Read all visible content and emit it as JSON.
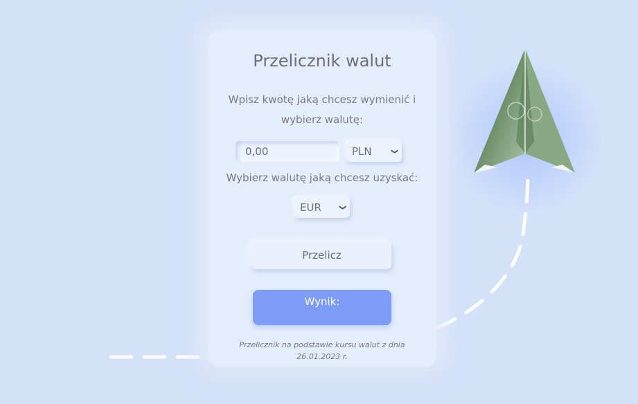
{
  "card": {
    "title": "Przelicznik walut",
    "instruction": "Wpisz kwotę jaką chcesz wymienić i wybierz walutę:",
    "amount_value": "0,00",
    "from_currency": "PLN",
    "target_instruction": "Wybierz walutę jaką chcesz uzyskać:",
    "to_currency": "EUR",
    "convert_label": "Przelicz",
    "result_label": "Wynik:",
    "footnote": "Przelicznik na podstawie kursu walut z dnia 26.01.2023 r."
  },
  "colors": {
    "background": "#d3e1f9",
    "card": "#e4edfc",
    "accent": "#7c9cf8",
    "text": "#6f6f73"
  },
  "icons": {
    "decoration": "paper-plane-banknote-icon",
    "select_arrow": "chevron-down-icon"
  }
}
